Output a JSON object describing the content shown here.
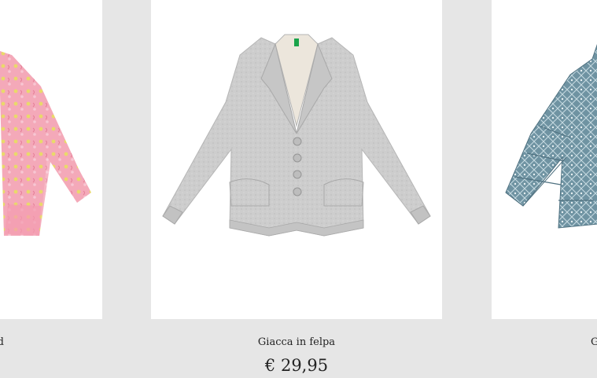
{
  "products": [
    {
      "name": "d",
      "price": "",
      "image_icon": "pink-floral-jacket-image",
      "color": "#f2a6b8"
    },
    {
      "name": "Giacca in felpa",
      "price": "€ 29,95",
      "image_icon": "grey-sweatshirt-blazer-image",
      "color": "#cfcfcf"
    },
    {
      "name": "G",
      "price": "",
      "image_icon": "teal-patterned-puffer-jacket-image",
      "color": "#6f93a2"
    }
  ],
  "colors": {
    "page_background": "#e6e6e6",
    "card_background": "#ffffff",
    "text": "#222222"
  }
}
